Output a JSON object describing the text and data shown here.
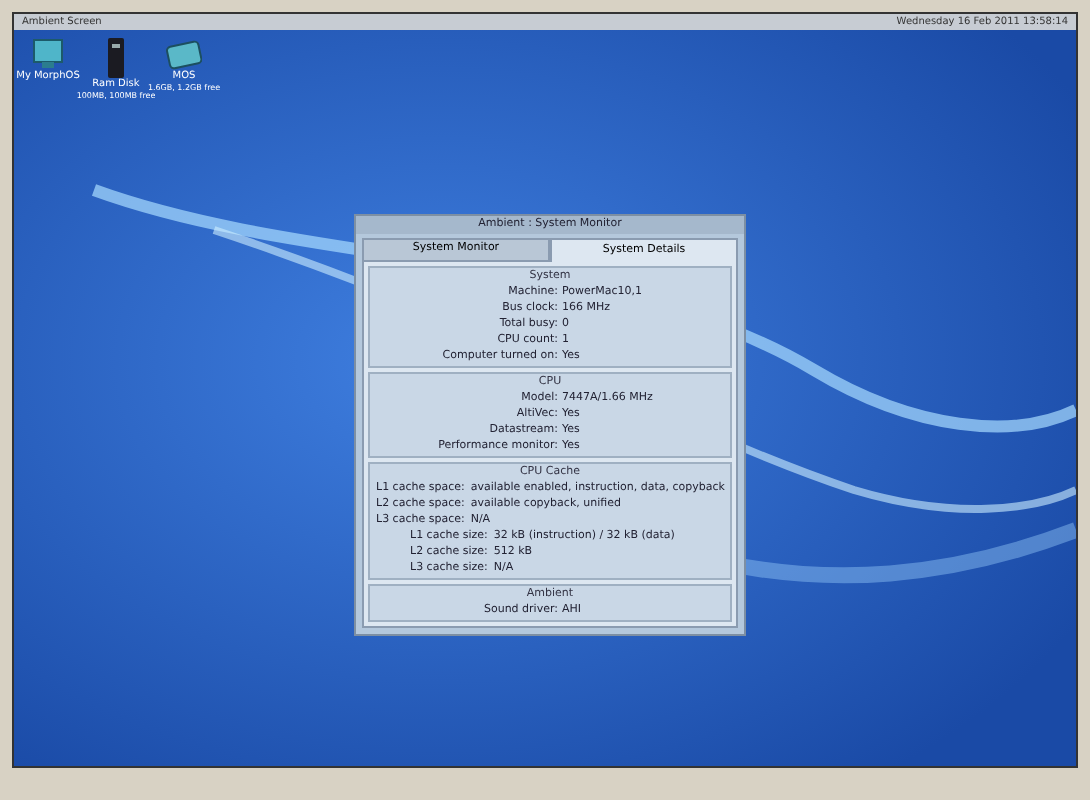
{
  "menu_bar": {
    "title": "Ambient Screen",
    "clock": "Wednesday 16 Feb 2011 13:58:14"
  },
  "desktop_icons": [
    {
      "kind": "computer",
      "label": "My MorphOS"
    },
    {
      "kind": "ramdisk",
      "label": "Ram Disk",
      "info": "100MB, 100MB free"
    },
    {
      "kind": "drive",
      "label": "MOS",
      "info": "1.6GB, 1.2GB free"
    }
  ],
  "window": {
    "title": "Ambient : System Monitor",
    "tabs": [
      {
        "label": "System Monitor",
        "selected": false
      },
      {
        "label": "System Details",
        "selected": true
      }
    ],
    "sections": [
      {
        "title": "System",
        "rows": [
          {
            "kind": "aligned",
            "label": "Machine:",
            "value": "PowerMac10,1"
          },
          {
            "kind": "aligned",
            "label": "Bus clock:",
            "value": "166 MHz"
          },
          {
            "kind": "aligned",
            "label": "Total busy:",
            "value": "0"
          },
          {
            "kind": "aligned",
            "label": "CPU count:",
            "value": "1"
          },
          {
            "kind": "aligned",
            "label": "Computer turned on:",
            "value": "Yes"
          }
        ]
      },
      {
        "title": "CPU",
        "rows": [
          {
            "kind": "aligned",
            "label": "Model:",
            "value": "7447A/1.66 MHz"
          },
          {
            "kind": "aligned",
            "label": "AltiVec:",
            "value": "Yes"
          },
          {
            "kind": "aligned",
            "label": "Datastream:",
            "value": "Yes"
          },
          {
            "kind": "aligned",
            "label": "Performance monitor:",
            "value": "Yes"
          }
        ]
      },
      {
        "title": "CPU Cache",
        "rows": [
          {
            "kind": "left",
            "label": "L1 cache space:",
            "value": "available enabled, instruction, data, copyback"
          },
          {
            "kind": "left",
            "label": "L2 cache space:",
            "value": "available copyback, unified"
          },
          {
            "kind": "left",
            "label": "L3 cache space:",
            "value": "N/A"
          },
          {
            "kind": "indented",
            "label": "L1 cache size:",
            "value": "32 kB (instruction) / 32 kB (data)"
          },
          {
            "kind": "indented",
            "label": "L2 cache size:",
            "value": "512 kB"
          },
          {
            "kind": "indented",
            "label": "L3 cache size:",
            "value": "N/A"
          }
        ]
      },
      {
        "title": "Ambient",
        "rows": [
          {
            "kind": "aligned",
            "label": "Sound driver:",
            "value": "AHI"
          }
        ]
      }
    ]
  }
}
